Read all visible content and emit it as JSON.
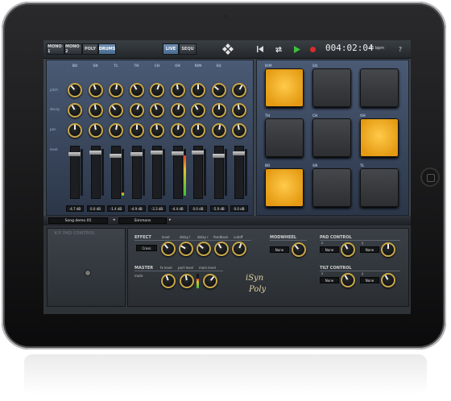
{
  "topbar": {
    "modes": [
      "MONO 1",
      "MONO 2",
      "POLY",
      "DRUMS"
    ],
    "views": [
      "LIVE",
      "SEQU"
    ],
    "time": "004:02:04",
    "bpm": "46 bpm",
    "help": "?"
  },
  "mixer": {
    "channels": [
      "BD",
      "SN",
      "TL",
      "TH",
      "CH",
      "OH",
      "RIM",
      "SQ",
      ""
    ],
    "row_labels": [
      "pitch",
      "decay",
      "pan",
      "level"
    ],
    "db": [
      "-4.7 dB",
      "0.0 dB",
      "-1.4 dB",
      "-4.9 dB",
      "-3.3 dB",
      "-4.4 dB",
      "0.0 dB",
      "-5.0 dB",
      "0.0 dB"
    ],
    "fader_levels": [
      0.88,
      0.92,
      0.85,
      0.88,
      0.92,
      0.9,
      0.92,
      0.85,
      0.9
    ]
  },
  "pads": {
    "labels": [
      "RIM",
      "SQ",
      "",
      "TH",
      "CH",
      "OH",
      "BD",
      "SN",
      "TL"
    ],
    "lit": [
      true,
      false,
      false,
      false,
      false,
      true,
      true,
      false,
      false
    ]
  },
  "songbar": {
    "song": "Song demo 05",
    "kit": "Simmons"
  },
  "xy": {
    "title": "X/Y PAD CONTROL"
  },
  "effect": {
    "title": "EFFECT",
    "type": "Cross",
    "knob_labels": [
      "level",
      "delay l",
      "delay r",
      "feedback",
      "cutoff"
    ]
  },
  "master": {
    "title": "MASTER",
    "mute": "mute",
    "knob_labels": [
      "fx level",
      "part level",
      "main level"
    ]
  },
  "modwheel": {
    "title": "MODWHEEL",
    "value": "None"
  },
  "pad_control": {
    "title": "PAD CONTROL",
    "x_label": "x",
    "y_label": "y",
    "x_value": "None",
    "y_value": "None"
  },
  "tilt_control": {
    "title": "TILT CONTROL",
    "x_label": "x",
    "y_label": "y",
    "x_value": "None",
    "y_value": "None"
  },
  "brand": {
    "line1": "iSyn",
    "line2": "Poly"
  },
  "colors": {
    "accent": "#e6a21b",
    "active_button": "#5b7ea3"
  }
}
